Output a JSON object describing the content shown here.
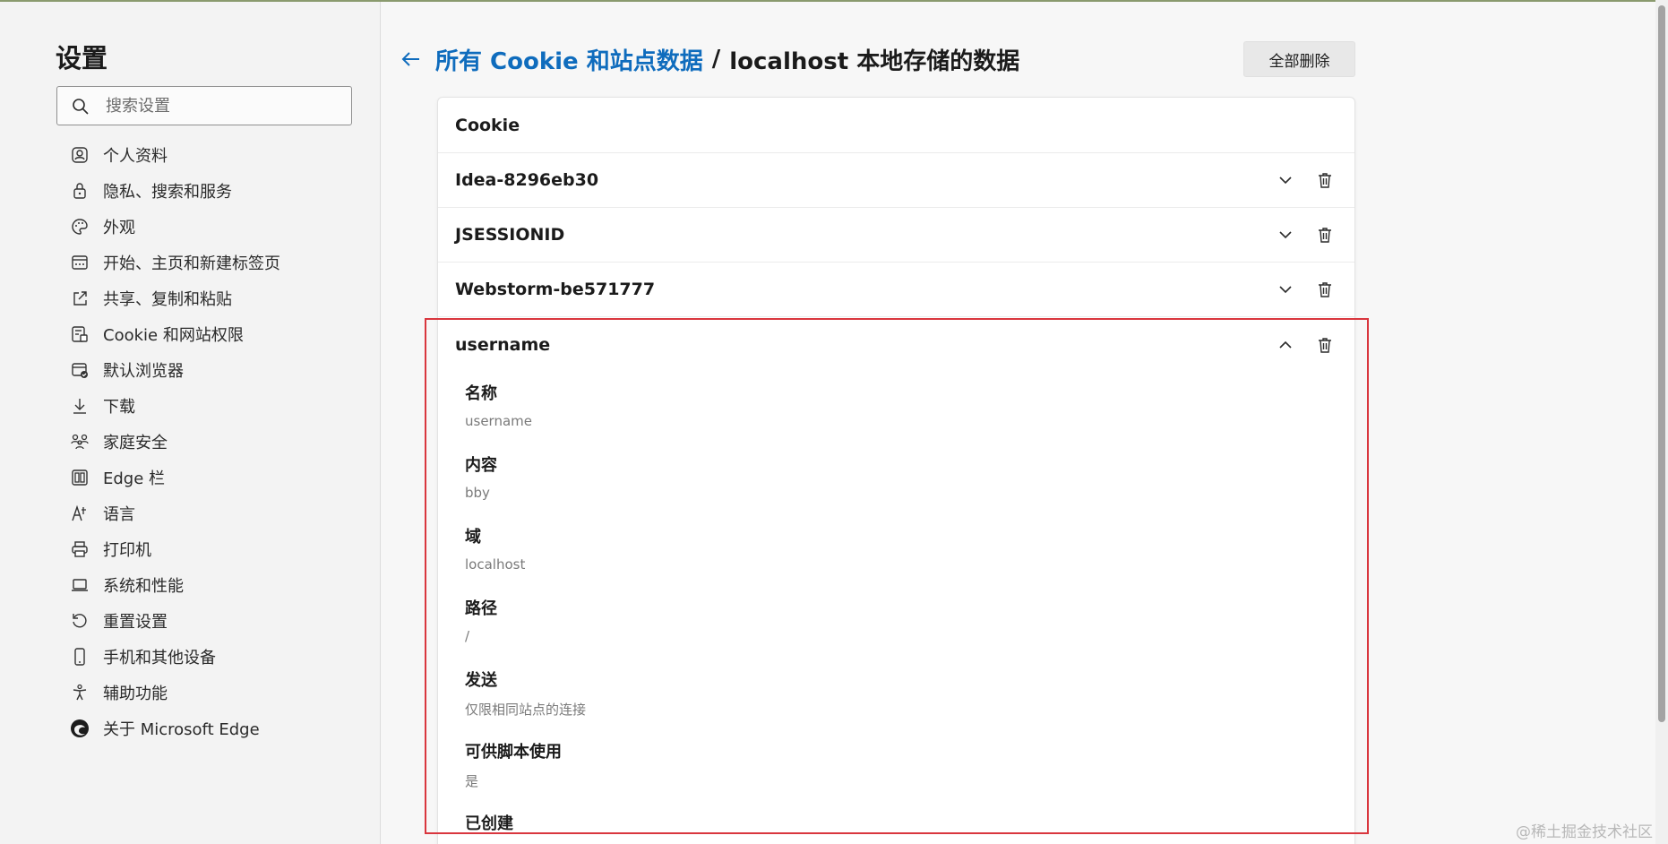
{
  "sidebar": {
    "title": "设置",
    "search_placeholder": "搜索设置",
    "items": [
      {
        "label": "个人资料",
        "icon": "profile-icon"
      },
      {
        "label": "隐私、搜索和服务",
        "icon": "lock-icon"
      },
      {
        "label": "外观",
        "icon": "palette-icon"
      },
      {
        "label": "开始、主页和新建标签页",
        "icon": "home-tab-icon"
      },
      {
        "label": "共享、复制和粘贴",
        "icon": "share-icon"
      },
      {
        "label": "Cookie 和网站权限",
        "icon": "site-permissions-icon"
      },
      {
        "label": "默认浏览器",
        "icon": "default-browser-icon"
      },
      {
        "label": "下载",
        "icon": "download-icon"
      },
      {
        "label": "家庭安全",
        "icon": "family-icon"
      },
      {
        "label": "Edge 栏",
        "icon": "edge-bar-icon"
      },
      {
        "label": "语言",
        "icon": "language-icon"
      },
      {
        "label": "打印机",
        "icon": "printer-icon"
      },
      {
        "label": "系统和性能",
        "icon": "laptop-icon"
      },
      {
        "label": "重置设置",
        "icon": "reset-icon"
      },
      {
        "label": "手机和其他设备",
        "icon": "phone-icon"
      },
      {
        "label": "辅助功能",
        "icon": "accessibility-icon"
      },
      {
        "label": "关于 Microsoft Edge",
        "icon": "edge-logo-icon"
      }
    ]
  },
  "header": {
    "breadcrumb_link": "所有 Cookie 和站点数据",
    "separator": "/",
    "current": "localhost 本地存储的数据",
    "delete_all_label": "全部删除"
  },
  "cookies": {
    "section_title": "Cookie",
    "rows": [
      {
        "name": "Idea-8296eb30"
      },
      {
        "name": "JSESSIONID"
      },
      {
        "name": "Webstorm-be571777"
      }
    ],
    "expanded": {
      "name": "username",
      "fields": [
        {
          "label": "名称",
          "value": "username"
        },
        {
          "label": "内容",
          "value": "bby"
        },
        {
          "label": "域",
          "value": "localhost"
        },
        {
          "label": "路径",
          "value": "/"
        },
        {
          "label": "发送",
          "value": "仅限相同站点的连接"
        },
        {
          "label": "可供脚本使用",
          "value": "是"
        },
        {
          "label": "已创建",
          "value": ""
        }
      ]
    }
  },
  "watermark": "@稀土掘金技术社区",
  "colors": {
    "accent": "#0f6cbd",
    "highlight": "#d9363e"
  }
}
